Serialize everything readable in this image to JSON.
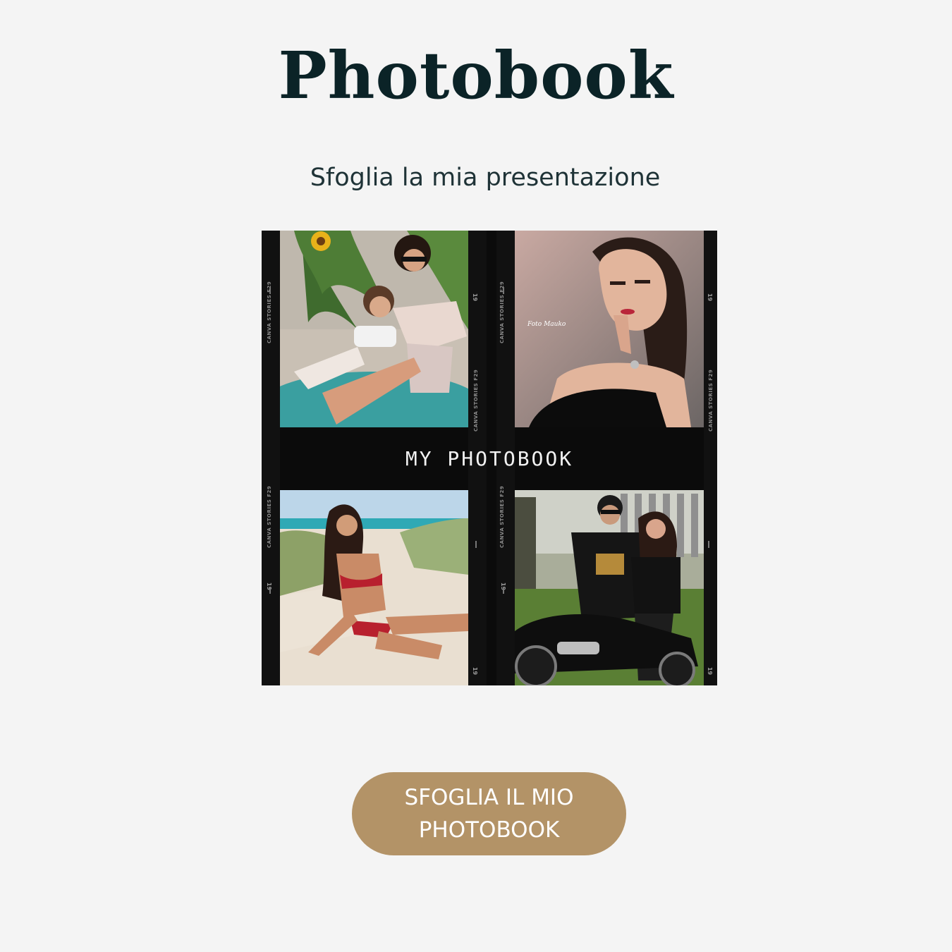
{
  "header": {
    "title": "Photobook",
    "subtitle": "Sfoglia la mia presentazione"
  },
  "collage": {
    "banner_text": "MY PHOTOBOOK",
    "film_brand": "CANVA STORIES F29",
    "frame_number": "19",
    "signature": "Foto Mauko"
  },
  "cta": {
    "label": "SFOGLIA IL MIO PHOTOBOOK"
  },
  "colors": {
    "background": "#f4f4f4",
    "title": "#0b2327",
    "button": "#b39367",
    "button_text": "#ffffff"
  }
}
